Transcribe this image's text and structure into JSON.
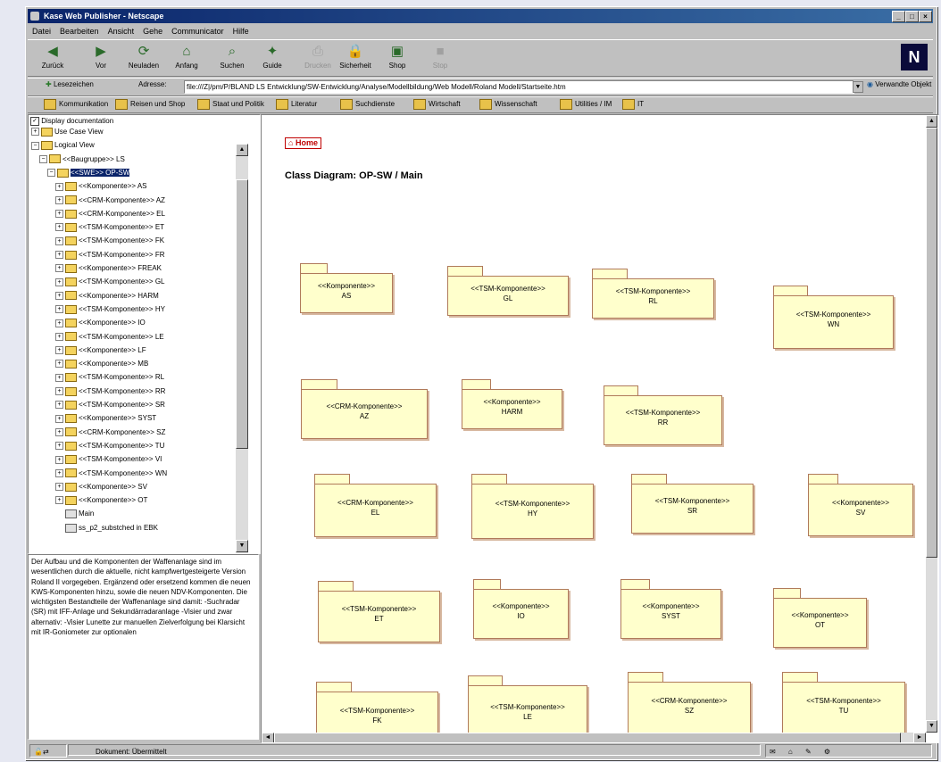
{
  "window": {
    "title": "Kase Web Publisher - Netscape"
  },
  "menu": [
    "Datei",
    "Bearbeiten",
    "Ansicht",
    "Gehe",
    "Communicator",
    "Hilfe"
  ],
  "nav_buttons": [
    {
      "label": "Zurück",
      "icon": "back-arrow-icon",
      "enabled": true
    },
    {
      "label": "Vor",
      "icon": "forward-arrow-icon",
      "enabled": true
    },
    {
      "label": "Neuladen",
      "icon": "reload-icon",
      "enabled": true
    },
    {
      "label": "Anfang",
      "icon": "home-icon",
      "enabled": true
    },
    {
      "label": "Suchen",
      "icon": "search-icon",
      "enabled": true
    },
    {
      "label": "Guide",
      "icon": "guide-icon",
      "enabled": true
    },
    {
      "label": "Drucken",
      "icon": "print-icon",
      "enabled": false
    },
    {
      "label": "Sicherheit",
      "icon": "security-lock-icon",
      "enabled": true
    },
    {
      "label": "Shop",
      "icon": "shop-icon",
      "enabled": true
    },
    {
      "label": "Stop",
      "icon": "stop-icon",
      "enabled": false
    }
  ],
  "address": {
    "bookmarks_label": "Lesezeichen",
    "address_label": "Adresse:",
    "url": "file:///Z|/pm/P/BLAND LS Entwicklung/SW-Entwicklung/Analyse/Modellbildung/Web Modell/Roland Modell/Startseite.htm",
    "related": "Verwandte Objekt"
  },
  "bookmarks": [
    "Kommunikation",
    "Reisen und Shop",
    "Staat und Politik",
    "Literatur",
    "Suchdienste",
    "Wirtschaft",
    "Wissenschaft",
    "Utilities / IM",
    "IT"
  ],
  "tree": {
    "header": "Display documentation",
    "items": [
      {
        "t": "Use Case View",
        "d": 0,
        "pm": "+",
        "ic": "folder"
      },
      {
        "t": "Logical View",
        "d": 0,
        "pm": "−",
        "ic": "folder"
      },
      {
        "t": "<<Baugruppe>> LS",
        "d": 1,
        "pm": "−",
        "ic": "folder"
      },
      {
        "t": "<<SWE>> OP-SW",
        "d": 2,
        "pm": "−",
        "ic": "folder",
        "sel": true
      },
      {
        "t": "<<Komponente>> AS",
        "d": 3,
        "pm": "+",
        "ic": "folder"
      },
      {
        "t": "<<CRM-Komponente>> AZ",
        "d": 3,
        "pm": "+",
        "ic": "folder"
      },
      {
        "t": "<<CRM-Komponente>> EL",
        "d": 3,
        "pm": "+",
        "ic": "folder"
      },
      {
        "t": "<<TSM-Komponente>> ET",
        "d": 3,
        "pm": "+",
        "ic": "folder"
      },
      {
        "t": "<<TSM-Komponente>> FK",
        "d": 3,
        "pm": "+",
        "ic": "folder"
      },
      {
        "t": "<<TSM-Komponente>> FR",
        "d": 3,
        "pm": "+",
        "ic": "folder"
      },
      {
        "t": "<<Komponente>> FREAK",
        "d": 3,
        "pm": "+",
        "ic": "folder"
      },
      {
        "t": "<<TSM-Komponente>> GL",
        "d": 3,
        "pm": "+",
        "ic": "folder"
      },
      {
        "t": "<<Komponente>> HARM",
        "d": 3,
        "pm": "+",
        "ic": "folder"
      },
      {
        "t": "<<TSM-Komponente>> HY",
        "d": 3,
        "pm": "+",
        "ic": "folder"
      },
      {
        "t": "<<Komponente>> IO",
        "d": 3,
        "pm": "+",
        "ic": "folder"
      },
      {
        "t": "<<TSM-Komponente>> LE",
        "d": 3,
        "pm": "+",
        "ic": "folder"
      },
      {
        "t": "<<Komponente>> LF",
        "d": 3,
        "pm": "+",
        "ic": "folder"
      },
      {
        "t": "<<Komponente>> MB",
        "d": 3,
        "pm": "+",
        "ic": "folder"
      },
      {
        "t": "<<TSM-Komponente>> RL",
        "d": 3,
        "pm": "+",
        "ic": "folder"
      },
      {
        "t": "<<TSM-Komponente>> RR",
        "d": 3,
        "pm": "+",
        "ic": "folder"
      },
      {
        "t": "<<TSM-Komponente>> SR",
        "d": 3,
        "pm": "+",
        "ic": "folder"
      },
      {
        "t": "<<Komponente>> SYST",
        "d": 3,
        "pm": "+",
        "ic": "folder"
      },
      {
        "t": "<<CRM-Komponente>> SZ",
        "d": 3,
        "pm": "+",
        "ic": "folder"
      },
      {
        "t": "<<TSM-Komponente>> TU",
        "d": 3,
        "pm": "+",
        "ic": "folder"
      },
      {
        "t": "<<TSM-Komponente>> VI",
        "d": 3,
        "pm": "+",
        "ic": "folder"
      },
      {
        "t": "<<TSM-Komponente>> WN",
        "d": 3,
        "pm": "+",
        "ic": "folder"
      },
      {
        "t": "<<Komponente>> SV",
        "d": 3,
        "pm": "+",
        "ic": "folder"
      },
      {
        "t": "<<Komponente>> OT",
        "d": 3,
        "pm": "+",
        "ic": "folder"
      },
      {
        "t": "Main",
        "d": 3,
        "pm": "",
        "ic": "diagram"
      },
      {
        "t": "ss_p2_substched in EBK",
        "d": 3,
        "pm": "",
        "ic": "diagram"
      }
    ]
  },
  "doc_text": "Der Aufbau und die Komponenten der Waffenanlage sind im wesentlichen durch die aktuelle, nicht kampfwertgesteigerte Version Roland II vorgegeben. Ergänzend oder ersetzend kommen die neuen KWS-Komponenten hinzu, sowie die neuen NDV-Komponenten. Die wichtigsten Bestandteile der Waffenanlage sind damit: -Suchradar (SR) mit IFF-Anlage und Sekundärradaranlage -Visier und zwar alternativ: -Visier Lunette zur manuellen Zielverfolgung bei Klarsicht mit IR-Goniometer zur optionalen",
  "content": {
    "home_label": "Home",
    "diagram_title": "Class Diagram: OP-SW / Main",
    "packages": [
      {
        "st": "<<Komponente>>",
        "nm": "AS"
      },
      {
        "st": "<<TSM-Komponente>>",
        "nm": "GL"
      },
      {
        "st": "<<TSM-Komponente>>",
        "nm": "RL"
      },
      {
        "st": "<<TSM-Komponente>>",
        "nm": "WN"
      },
      {
        "st": "<<CRM-Komponente>>",
        "nm": "AZ"
      },
      {
        "st": "<<Komponente>>",
        "nm": "HARM"
      },
      {
        "st": "<<TSM-Komponente>>",
        "nm": "RR"
      },
      {
        "st": "<<CRM-Komponente>>",
        "nm": "EL"
      },
      {
        "st": "<<TSM-Komponente>>",
        "nm": "HY"
      },
      {
        "st": "<<TSM-Komponente>>",
        "nm": "SR"
      },
      {
        "st": "<<Komponente>>",
        "nm": "SV"
      },
      {
        "st": "<<TSM-Komponente>>",
        "nm": "ET"
      },
      {
        "st": "<<Komponente>>",
        "nm": "IO"
      },
      {
        "st": "<<Komponente>>",
        "nm": "SYST"
      },
      {
        "st": "<<Komponente>>",
        "nm": "OT"
      },
      {
        "st": "<<TSM-Komponente>>",
        "nm": "FK"
      },
      {
        "st": "<<TSM-Komponente>>",
        "nm": "LE"
      },
      {
        "st": "<<CRM-Komponente>>",
        "nm": "SZ"
      },
      {
        "st": "<<TSM-Komponente>>",
        "nm": "TU"
      }
    ]
  },
  "status": {
    "text": "Dokument: Übermittelt"
  },
  "colors": {
    "title": "#0a246a",
    "pkg_fill": "#ffffcc",
    "pkg_border": "#b07a5a",
    "select": "#0a246a",
    "home": "#c00000"
  }
}
